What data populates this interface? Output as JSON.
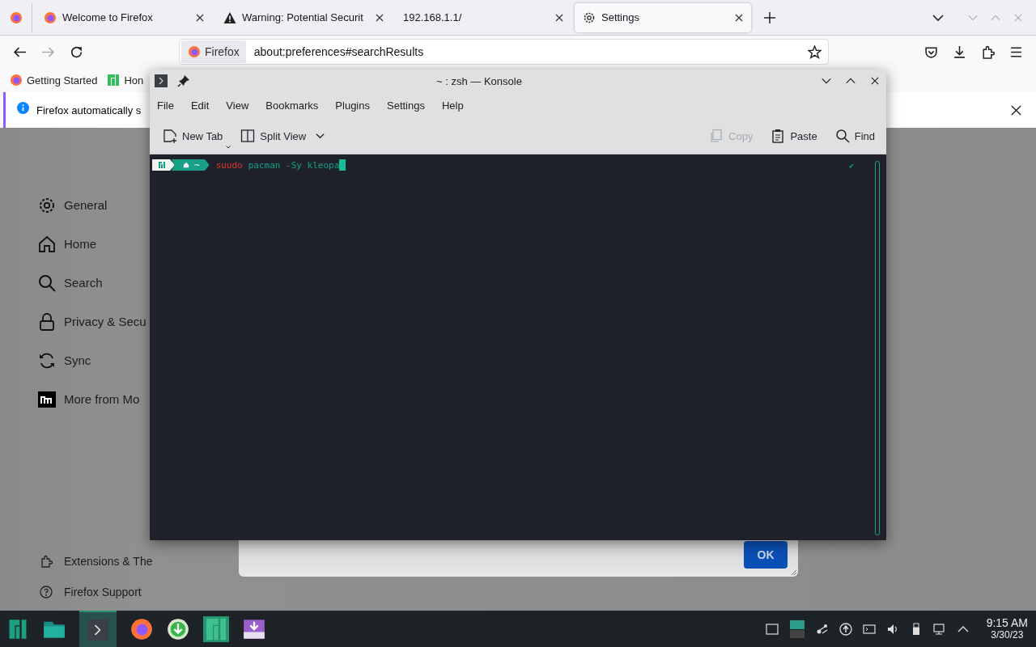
{
  "browser": {
    "tabs": [
      {
        "kind": "pinned",
        "selected": false
      },
      {
        "label": "Welcome to Firefox",
        "kind": "firefox",
        "selected": false
      },
      {
        "label": "Warning: Potential Securit",
        "kind": "warning",
        "selected": false
      },
      {
        "label": "192.168.1.1/",
        "kind": "plain",
        "selected": false
      },
      {
        "label": "Settings",
        "kind": "settings",
        "selected": true
      }
    ],
    "identity": "Firefox",
    "url": "about:preferences#searchResults",
    "bookmarks": [
      {
        "label": "Getting Started",
        "kind": "firefox"
      },
      {
        "label": "Hon",
        "kind": "manjaro"
      }
    ],
    "notification": "Firefox automatically s",
    "nav": [
      {
        "label": "General",
        "kind": "gear"
      },
      {
        "label": "Home",
        "kind": "home"
      },
      {
        "label": "Search",
        "kind": "search"
      },
      {
        "label": "Privacy & Secu",
        "kind": "lock"
      },
      {
        "label": "Sync",
        "kind": "sync"
      },
      {
        "label": "More from Mo",
        "kind": "mozilla"
      }
    ],
    "footer_links": [
      {
        "label": "Extensions & The",
        "kind": "puzzle"
      },
      {
        "label": "Firefox Support",
        "kind": "help"
      }
    ],
    "dialog": {
      "button": "OK"
    }
  },
  "konsole": {
    "title": "~ : zsh — Konsole",
    "menu": [
      "File",
      "Edit",
      "View",
      "Bookmarks",
      "Plugins",
      "Settings",
      "Help"
    ],
    "toolbar": [
      {
        "label": "New Tab",
        "kind": "newtab",
        "disabled": false
      },
      {
        "label": "Split View",
        "kind": "split",
        "disabled": false
      },
      {
        "label": "Copy",
        "kind": "copy",
        "disabled": true
      },
      {
        "label": "Paste",
        "kind": "paste",
        "disabled": false
      },
      {
        "label": "Find",
        "kind": "find",
        "disabled": false
      }
    ],
    "prompt_dir": "~",
    "command": [
      {
        "text": "suudo",
        "kind": "error"
      },
      {
        "text": "pacman -Sy kleopa",
        "kind": "arg"
      }
    ],
    "status": "✔"
  },
  "taskbar": {
    "time": "9:15 AM",
    "date": "3/30/23"
  }
}
